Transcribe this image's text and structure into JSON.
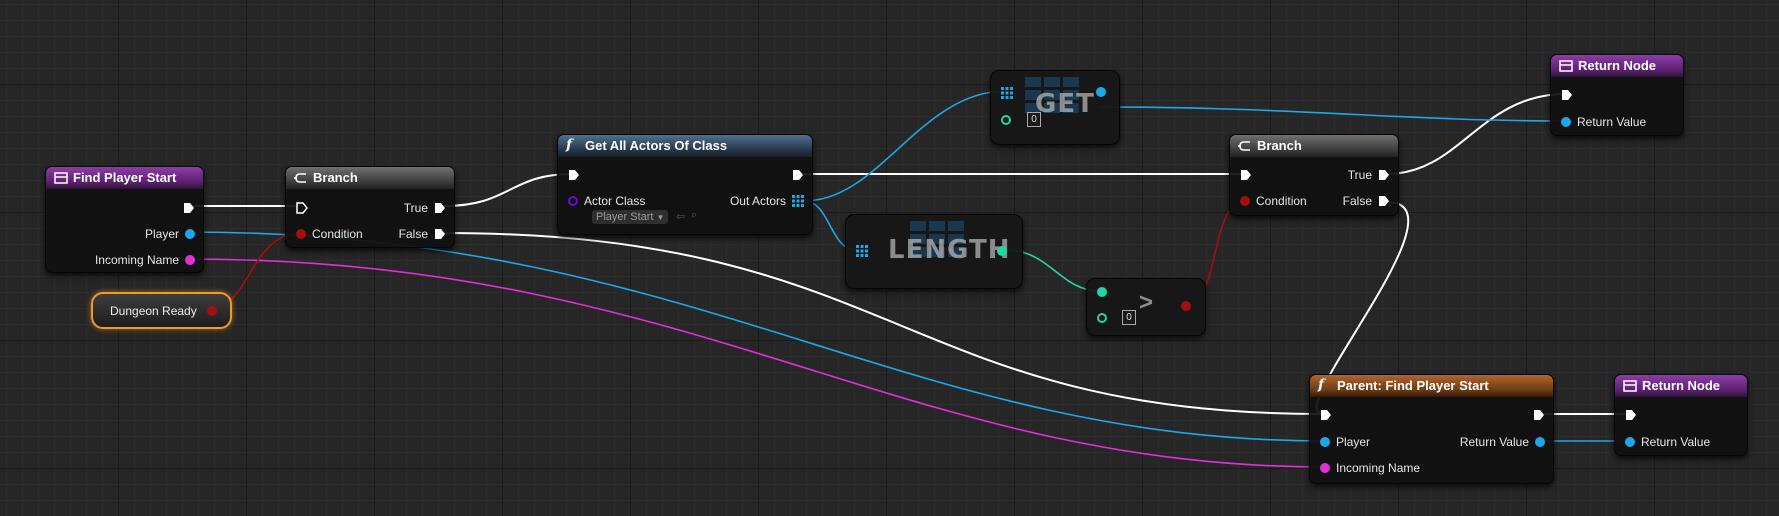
{
  "colors": {
    "exec": "#ffffff",
    "object": "#1ea7e8",
    "name": "#e22fd8",
    "bool": "#a30f0f",
    "int": "#22d6a4",
    "class": "#5f0fd4"
  },
  "nodes": {
    "find_player_start": {
      "title": "Find Player Start",
      "player": "Player",
      "incoming_name": "Incoming Name"
    },
    "dungeon_ready": {
      "label": "Dungeon Ready"
    },
    "branch1": {
      "title": "Branch",
      "condition": "Condition",
      "true_label": "True",
      "false_label": "False"
    },
    "get_all_actors": {
      "title": "Get All Actors Of Class",
      "actor_class": "Actor Class",
      "actor_class_value": "Player Start",
      "out_actors": "Out Actors"
    },
    "get": {
      "title": "GET",
      "index": "0"
    },
    "length": {
      "title": "LENGTH"
    },
    "greater": {
      "symbol": ">",
      "value": "0"
    },
    "branch2": {
      "title": "Branch",
      "condition": "Condition",
      "true_label": "True",
      "false_label": "False"
    },
    "return_top": {
      "title": "Return Node",
      "return_value": "Return Value"
    },
    "parent_find": {
      "title": "Parent: Find Player Start",
      "player": "Player",
      "incoming_name": "Incoming Name",
      "return_value": "Return Value"
    },
    "return_bottom": {
      "title": "Return Node",
      "return_value": "Return Value"
    }
  }
}
